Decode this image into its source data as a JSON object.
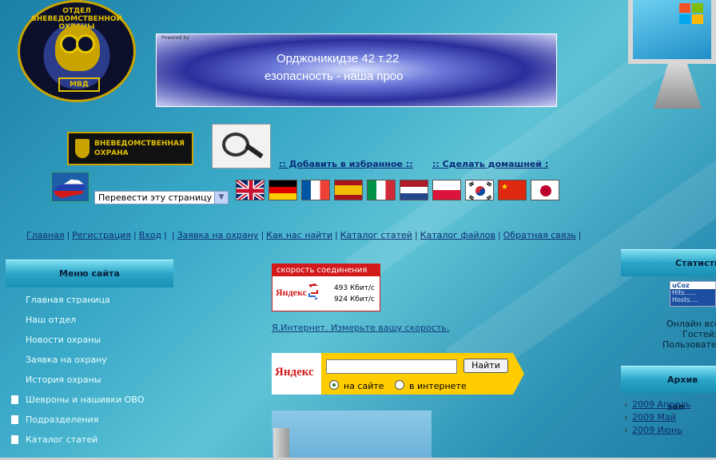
{
  "emblem": {
    "ring_text": "ОТДЕЛ ВНЕВЕДОМСТВЕННОЙ ОХРАНЫ",
    "badge_text": "МВД"
  },
  "banner": {
    "powered_by": "Powered by",
    "line1": "Орджоникидзе 42 т.22",
    "line2": "езопасность - наша проо"
  },
  "patch": {
    "line1": "ВНЕВЕДОМСТВЕННАЯ",
    "line2": "ОХРАНА"
  },
  "top_links": {
    "favorites": ":: Добавить в избранное ::",
    "homepage": ":: Сделать домашней :"
  },
  "translate": {
    "label": "Перевести эту страницу"
  },
  "flags": [
    {
      "name": "english"
    },
    {
      "name": "german"
    },
    {
      "name": "french"
    },
    {
      "name": "spanish"
    },
    {
      "name": "italian"
    },
    {
      "name": "dutch"
    },
    {
      "name": "polish"
    },
    {
      "name": "korean"
    },
    {
      "name": "chinese"
    },
    {
      "name": "japanese"
    }
  ],
  "nav": {
    "items": [
      "Главная",
      "Регистрация",
      "Вход",
      "Заявка на охрану",
      "Как нас найти",
      "Каталог статей",
      "Каталог файлов",
      "Обратная связь"
    ]
  },
  "menu": {
    "title": "Меню сайта",
    "items": [
      {
        "label": "Главная страница",
        "icon": false
      },
      {
        "label": "Наш отдел",
        "icon": false
      },
      {
        "label": "Новости охраны",
        "icon": false
      },
      {
        "label": "Заявка на охрану",
        "icon": false
      },
      {
        "label": "История охраны",
        "icon": false
      },
      {
        "label": "Шевроны и нашивки ОВО",
        "icon": true
      },
      {
        "label": "Подразделения",
        "icon": true
      },
      {
        "label": "Каталог статей",
        "icon": true
      }
    ]
  },
  "speed_widget": {
    "header": "скорость соединения",
    "logo": "Яндекс",
    "value1": "493 Кбит/с",
    "value2": "924 Кбит/с"
  },
  "measure_link": "Я.Интернет. Измерьте вашу скорость.",
  "yandex_search": {
    "logo": "Яндекс",
    "button": "Найти",
    "radio_site": "на сайте",
    "radio_web": "в интернете"
  },
  "stats": {
    "title": "Статисти",
    "ucoz_title": "uCoz",
    "hits": "Hits......",
    "hosts": "Hosts....",
    "online_lines": [
      "Онлайн все",
      "Гостей:",
      "Пользовате"
    ]
  },
  "archive": {
    "title": "Архив зап",
    "items": [
      "2009 Апрель",
      "2009 Май",
      "2009 Июнь"
    ]
  },
  "colors": {
    "link": "#0d2d74",
    "accent_red": "#d31a1a",
    "yandex_yellow": "#ffcc00",
    "gold": "#c9a400"
  }
}
